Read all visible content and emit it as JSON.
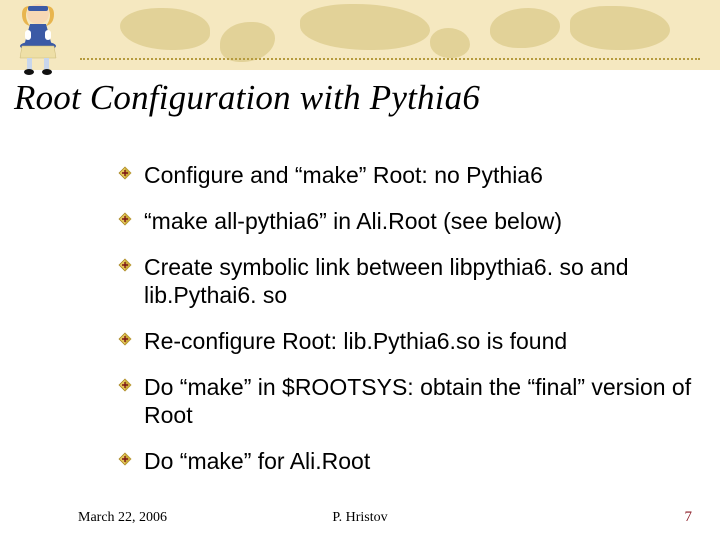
{
  "slide": {
    "title": "Root Configuration with Pythia6",
    "bullets": [
      "Configure and “make” Root: no Pythia6",
      "“make all-pythia6” in Ali.Root (see below)",
      "Create symbolic link between libpythia6. so and lib.Pythai6. so",
      "Re-configure Root: lib.Pythia6.so is found",
      "Do “make” in $ROOTSYS: obtain the “final” version of Root",
      "Do “make” for Ali.Root"
    ]
  },
  "footer": {
    "date": "March 22, 2006",
    "author": "P. Hristov",
    "page": "7"
  }
}
